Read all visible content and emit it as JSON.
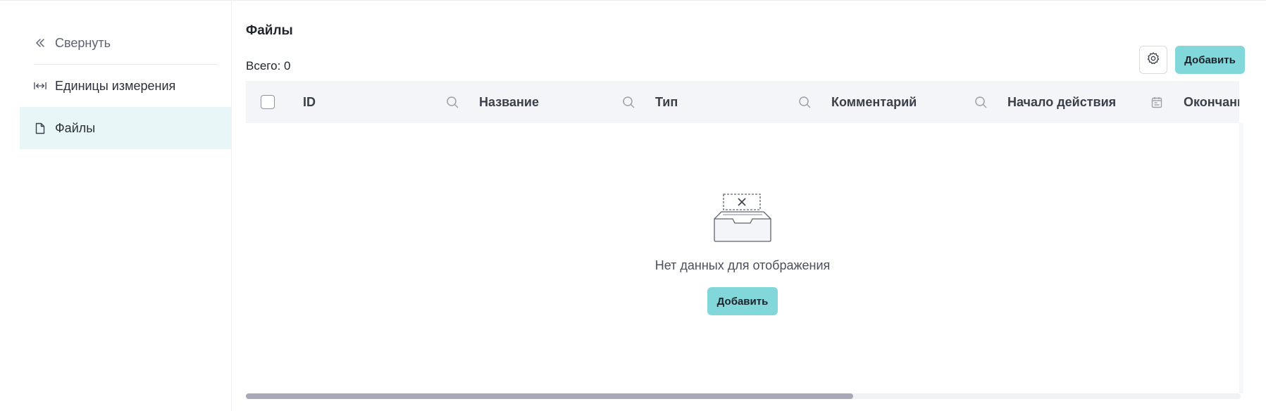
{
  "sidebar": {
    "collapse_label": "Свернуть",
    "items": [
      {
        "label": "Единицы измерения",
        "icon": "ruler-arrows-icon",
        "active": false
      },
      {
        "label": "Файлы",
        "icon": "file-icon",
        "active": true
      }
    ]
  },
  "main": {
    "title": "Файлы",
    "total_label": "Всего: 0",
    "add_button": "Добавить",
    "settings_icon": "gear-icon"
  },
  "table": {
    "columns": [
      {
        "label": "ID",
        "filter_icon": "search-icon"
      },
      {
        "label": "Название",
        "filter_icon": "search-icon"
      },
      {
        "label": "Тип",
        "filter_icon": "search-icon"
      },
      {
        "label": "Комментарий",
        "filter_icon": "search-icon"
      },
      {
        "label": "Начало действия",
        "filter_icon": "calendar-icon"
      },
      {
        "label": "Окончани",
        "filter_icon": ""
      }
    ]
  },
  "empty_state": {
    "message": "Нет данных для отображения",
    "add_button": "Добавить"
  },
  "colors": {
    "accent": "#82d7db",
    "active_bg": "#e9f6f7",
    "header_bg": "#f4f5f8",
    "scroll_thumb": "#a7a9b6"
  },
  "scroll": {
    "horizontal_position": 0.0,
    "visible_fraction": 0.61
  }
}
